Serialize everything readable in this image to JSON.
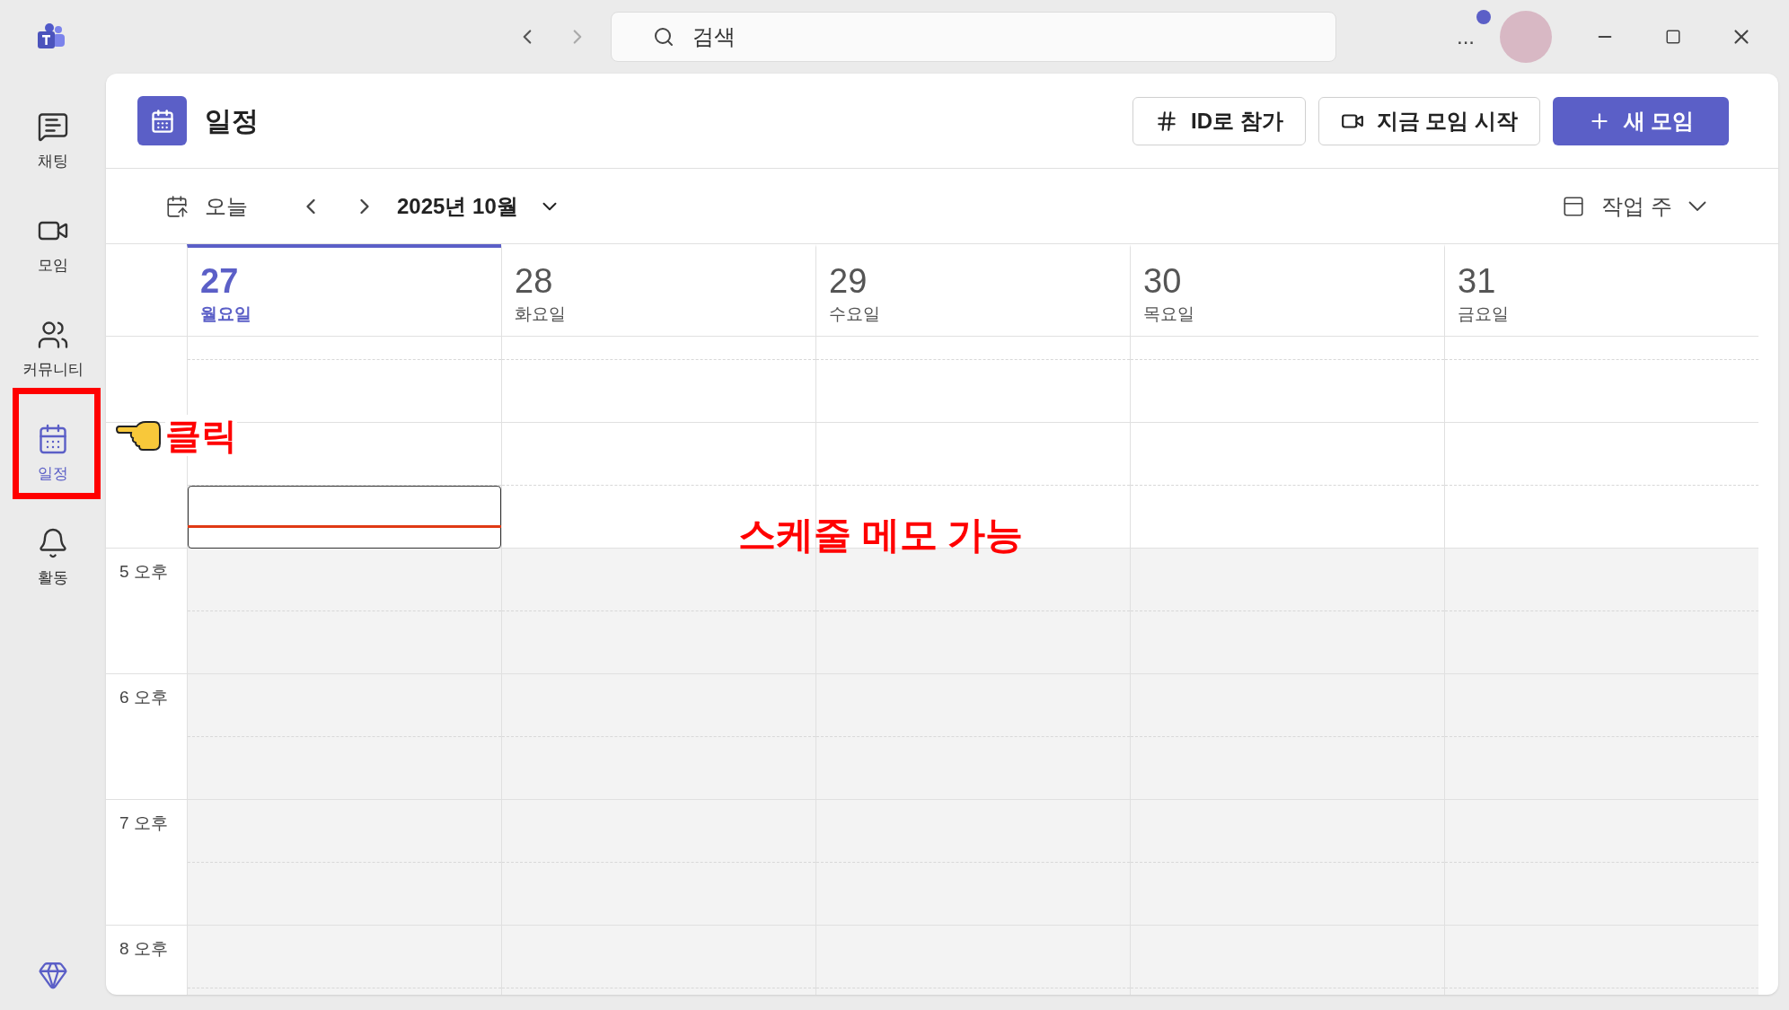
{
  "titlebar": {
    "search": {
      "placeholder": "검색"
    },
    "more": "...",
    "has_notification": true
  },
  "rail": {
    "items": [
      {
        "kind": "chat",
        "label": "채팅",
        "selected": false
      },
      {
        "kind": "meet",
        "label": "모임",
        "selected": false
      },
      {
        "kind": "community",
        "label": "커뮤니티",
        "selected": false
      },
      {
        "kind": "calendar",
        "label": "일정",
        "selected": true
      },
      {
        "kind": "activity",
        "label": "활동",
        "selected": false
      }
    ]
  },
  "header": {
    "title": "일정",
    "buttons": [
      {
        "kind": "join",
        "label": "ID로 참가"
      },
      {
        "kind": "meet_now",
        "label": "지금 모임 시작"
      },
      {
        "kind": "new",
        "label": "새 모임"
      }
    ]
  },
  "toolbar": {
    "today": "오늘",
    "month": "2025년 10월",
    "view": "작업 주"
  },
  "days": [
    {
      "date": "27",
      "weekday": "월요일",
      "selected": true
    },
    {
      "date": "28",
      "weekday": "화요일",
      "selected": false
    },
    {
      "date": "29",
      "weekday": "수요일",
      "selected": false
    },
    {
      "date": "30",
      "weekday": "목요일",
      "selected": false
    },
    {
      "date": "31",
      "weekday": "금요일",
      "selected": false
    }
  ],
  "rows": [
    {
      "shaded": false,
      "slot_selected": true,
      "now_line": true
    },
    {
      "time": "5 오후",
      "shaded": true
    },
    {
      "time": "6 오후",
      "shaded": true
    },
    {
      "time": "7 오후",
      "shaded": true
    },
    {
      "time": "8 오후",
      "shaded": true
    }
  ],
  "annotations": {
    "click": "클릭",
    "memo": "스케줄 메모 가능"
  }
}
